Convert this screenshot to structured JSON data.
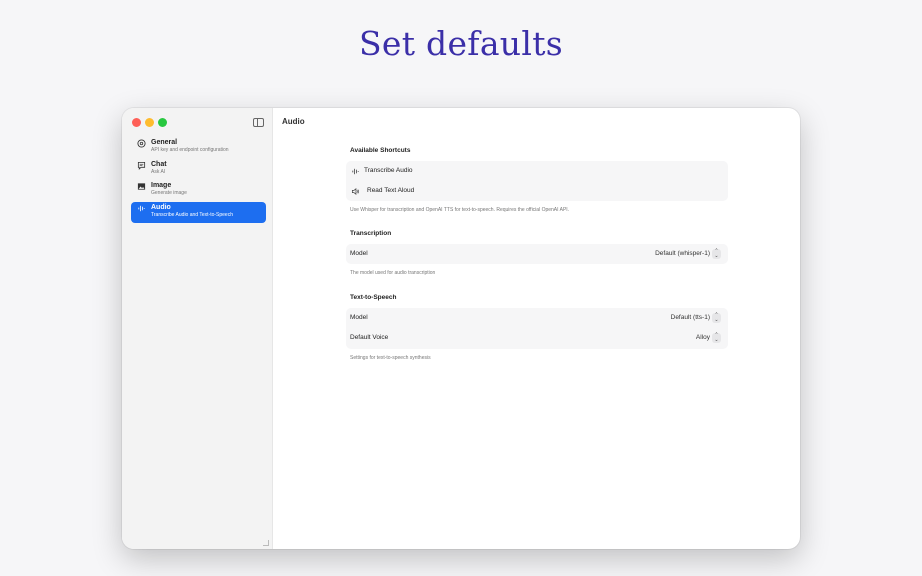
{
  "hero": {
    "title": "Set defaults"
  },
  "sidebar": {
    "items": [
      {
        "label": "General",
        "sub": "API key and endpoint configuration",
        "icon": "gear-icon"
      },
      {
        "label": "Chat",
        "sub": "Ask AI",
        "icon": "chat-icon"
      },
      {
        "label": "Image",
        "sub": "Generate image",
        "icon": "image-icon"
      },
      {
        "label": "Audio",
        "sub": "Transcribe Audio and Text-to-Speech",
        "icon": "waveform-icon",
        "active": true
      }
    ]
  },
  "content": {
    "title": "Audio",
    "shortcuts": {
      "heading": "Available Shortcuts",
      "items": [
        {
          "label": "Transcribe Audio",
          "icon": "waveform-icon"
        },
        {
          "label": "Read Text Aloud",
          "icon": "speaker-icon"
        }
      ],
      "note": "Use Whisper for transcription and OpenAI TTS for text-to-speech. Requires the official OpenAI API."
    },
    "transcription": {
      "heading": "Transcription",
      "model_label": "Model",
      "model_value": "Default (whisper-1)",
      "note": "The model used for audio transcription"
    },
    "tts": {
      "heading": "Text-to-Speech",
      "model_label": "Model",
      "model_value": "Default (tts-1)",
      "voice_label": "Default Voice",
      "voice_value": "Alloy",
      "note": "Settings for text-to-speech synthesis"
    }
  },
  "colors": {
    "accent": "#1d6ef0",
    "hero": "#3b2fa8"
  }
}
